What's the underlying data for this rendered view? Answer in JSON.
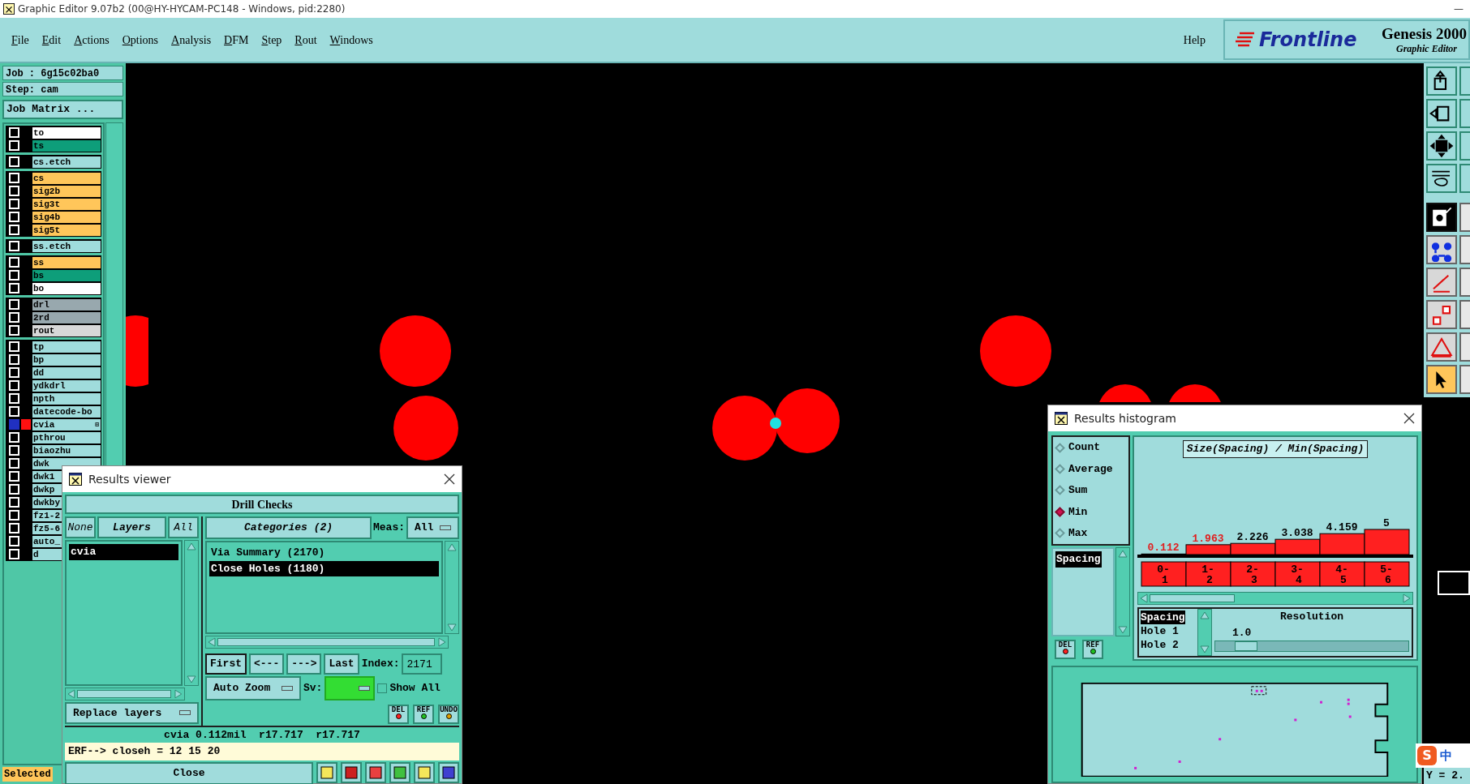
{
  "title_bar": {
    "title": "Graphic Editor 9.07b2 (00@HY-HYCAM-PC148 - Windows, pid:2280)",
    "minimize": "—"
  },
  "menu": [
    {
      "label": "File"
    },
    {
      "label": "Edit"
    },
    {
      "label": "Actions"
    },
    {
      "label": "Options"
    },
    {
      "label": "Analysis"
    },
    {
      "label": "DFM"
    },
    {
      "label": "Step"
    },
    {
      "label": "Rout"
    },
    {
      "label": "Windows"
    }
  ],
  "help": "Help",
  "brand": {
    "logo": "Frontline",
    "product": "Genesis 2000",
    "subtitle": "Graphic Editor"
  },
  "job": {
    "job": "Job : 6g15c02ba0",
    "step": "Step: cam",
    "matrix_button": "Job Matrix ..."
  },
  "layer_groups": [
    [
      {
        "name": "to",
        "color": "#ffffff",
        "selected": false
      },
      {
        "name": "ts",
        "color": "#0e9e7a",
        "selected": false
      }
    ],
    [
      {
        "name": "cs.etch",
        "color": "#9fdcdc",
        "selected": false
      }
    ],
    [
      {
        "name": "cs",
        "color": "#ffc65a",
        "selected": false
      },
      {
        "name": "sig2b",
        "color": "#ffc65a",
        "selected": false
      },
      {
        "name": "sig3t",
        "color": "#ffc65a",
        "selected": false
      },
      {
        "name": "sig4b",
        "color": "#ffc65a",
        "selected": false
      },
      {
        "name": "sig5t",
        "color": "#ffc65a",
        "selected": false
      }
    ],
    [
      {
        "name": "ss.etch",
        "color": "#9fdcdc",
        "selected": false
      }
    ],
    [
      {
        "name": "ss",
        "color": "#ffc65a",
        "selected": false
      },
      {
        "name": "bs",
        "color": "#0e9e7a",
        "selected": false
      },
      {
        "name": "bo",
        "color": "#ffffff",
        "selected": false
      }
    ],
    [
      {
        "name": "drl",
        "color": "#98a8ae",
        "selected": false
      },
      {
        "name": "2rd",
        "color": "#98a8ae",
        "selected": false
      },
      {
        "name": "rout",
        "color": "#d8d8d8",
        "selected": false
      }
    ],
    [
      {
        "name": "tp",
        "color": "#9fdcdc",
        "selected": false
      },
      {
        "name": "bp",
        "color": "#9fdcdc",
        "selected": false
      },
      {
        "name": "dd",
        "color": "#9fdcdc",
        "selected": false
      },
      {
        "name": "ydkdrl",
        "color": "#9fdcdc",
        "selected": false
      },
      {
        "name": "npth",
        "color": "#9fdcdc",
        "selected": false
      },
      {
        "name": "datecode-bo",
        "color": "#9fdcdc",
        "selected": false
      },
      {
        "name": "cvia",
        "color": "#9fdcdc",
        "selected": true,
        "badge": "⊞"
      },
      {
        "name": "pthrou",
        "color": "#9fdcdc",
        "selected": false
      },
      {
        "name": "biaozhu",
        "color": "#9fdcdc",
        "selected": false
      },
      {
        "name": "dwk",
        "color": "#9fdcdc",
        "selected": false
      },
      {
        "name": "dwk1",
        "color": "#9fdcdc",
        "selected": false
      },
      {
        "name": "dwkp",
        "color": "#9fdcdc",
        "selected": false
      },
      {
        "name": "dwkby",
        "color": "#9fdcdc",
        "selected": false
      },
      {
        "name": "fz1-2",
        "color": "#9fdcdc",
        "selected": false
      },
      {
        "name": "fz5-6",
        "color": "#9fdcdc",
        "selected": false
      },
      {
        "name": "auto_",
        "color": "#9fdcdc",
        "selected": false
      },
      {
        "name": "d",
        "color": "#9fdcdc",
        "selected": false
      }
    ]
  ],
  "selected_label": "Selected",
  "toolbar": [
    {
      "selected": false,
      "on": false
    },
    {
      "selected": false,
      "on": false
    },
    {
      "selected": false,
      "on": false
    },
    {
      "selected": false,
      "on": false
    },
    {
      "selected": false,
      "on": true
    },
    {
      "selected": false,
      "on": false
    },
    {
      "selected": false,
      "on": false
    },
    {
      "selected": false,
      "on": false
    },
    {
      "selected": false,
      "on": false
    },
    {
      "selected": true,
      "on": false
    }
  ],
  "coordinate": "Y = 2.",
  "ime": "中",
  "ime_logo": "S",
  "results_viewer": {
    "title": "Results viewer",
    "heading": "Drill Checks",
    "layer_buttons": [
      "None",
      "Layers",
      "All"
    ],
    "layers": [
      {
        "name": "cvia",
        "selected": true
      }
    ],
    "replace_button": "Replace layers",
    "categories_button": "Categories (2)",
    "meas_label": "Meas:",
    "meas_value": "All",
    "categories": [
      {
        "name": "Via Summary (2170)",
        "selected": false
      },
      {
        "name": "Close Holes (1180)",
        "selected": true
      }
    ],
    "nav": [
      {
        "label": "First",
        "selected": true
      },
      {
        "label": "<---",
        "selected": false
      },
      {
        "label": "--->",
        "selected": false
      },
      {
        "label": "Last",
        "selected": false
      }
    ],
    "index_label": "Index:",
    "index_value": "2171",
    "zoom_value": "Auto Zoom",
    "sv_label": "Sv:",
    "show_all": {
      "label": "Show All",
      "checked": false
    },
    "edit_buttons": [
      "DEL",
      "REF",
      "UNDO"
    ],
    "status": "cvia 0.112mil  r17.717  r17.717",
    "erf": "ERF--> closeh = 12 15 20",
    "close_button": "Close"
  },
  "histogram": {
    "title": "Results histogram",
    "modes": [
      {
        "label": "Count",
        "selected": false
      },
      {
        "label": "Average",
        "selected": false
      },
      {
        "label": "Sum",
        "selected": false
      },
      {
        "label": "Min",
        "selected": true
      },
      {
        "label": "Max",
        "selected": false
      }
    ],
    "measures": [
      {
        "label": "Spacing",
        "selected": true
      }
    ],
    "edit_buttons": [
      "DEL",
      "REF"
    ],
    "flagged_bins": [
      true,
      true,
      false,
      false,
      false,
      false
    ],
    "chart_data": {
      "type": "bar",
      "title": "Size(Spacing) / Min(Spacing)",
      "categories": [
        "0-1",
        "1-2",
        "2-3",
        "3-4",
        "4-5",
        "5-6"
      ],
      "values": [
        0.112,
        1.963,
        2.226,
        3.038,
        4.159,
        5
      ],
      "value_labels": [
        "0.112",
        "1.963",
        "2.226",
        "3.038",
        "4.159",
        "5"
      ]
    },
    "fields": [
      {
        "label": "Spacing",
        "selected": true
      },
      {
        "label": "Hole 1",
        "selected": false
      },
      {
        "label": "Hole 2",
        "selected": false
      }
    ],
    "resolution": {
      "label": "Resolution",
      "value": "1.0",
      "level": 0.1
    }
  }
}
